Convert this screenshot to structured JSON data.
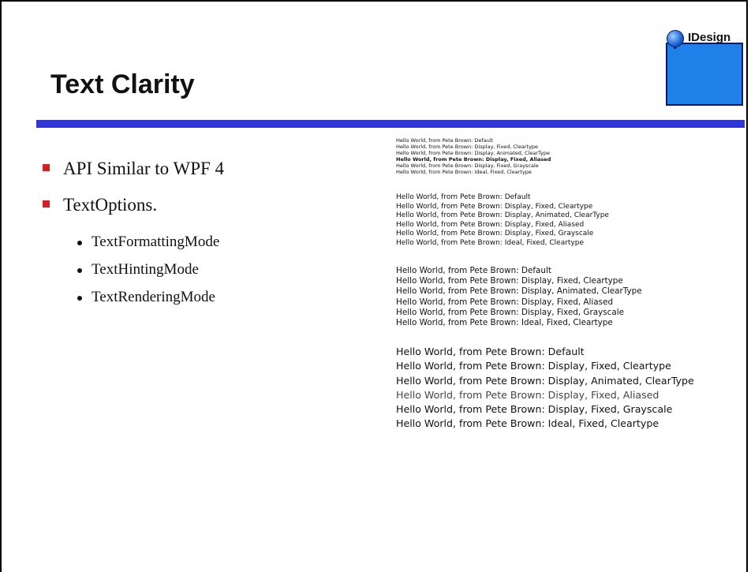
{
  "slide": {
    "title": "Text Clarity",
    "logo": {
      "text": "IDesign"
    },
    "accent_colors": {
      "rule": "#2f37d6",
      "bullet": "#d42027",
      "logo_box": "#1e80e8"
    },
    "bullets": [
      {
        "text": "API Similar to WPF 4",
        "sub": []
      },
      {
        "text": "TextOptions.",
        "sub": [
          "TextFormattingMode",
          "TextHintingMode",
          "TextRenderingMode"
        ]
      }
    ],
    "sample_groups": [
      {
        "lines": [
          "Hello World, from Pete Brown: Default",
          "Hello World, from Pete Brown: Display, Fixed, Cleartype",
          "Hello World, from Pete Brown: Display, Animated, ClearType",
          "Hello World, from Pete Brown: Display, Fixed, Aliased",
          "Hello World, from Pete Brown: Display, Fixed, Grayscale",
          "Hello World, from Pete Brown: Ideal, Fixed, Cleartype"
        ]
      },
      {
        "lines": [
          "Hello World, from Pete Brown: Default",
          "Hello World, from Pete Brown: Display, Fixed, Cleartype",
          "Hello World, from Pete Brown: Display, Animated, ClearType",
          "Hello World, from Pete Brown: Display, Fixed, Aliased",
          "Hello World, from Pete Brown: Display, Fixed, Grayscale",
          "Hello World, from Pete Brown: Ideal, Fixed, Cleartype"
        ]
      },
      {
        "lines": [
          "Hello World, from Pete Brown: Default",
          "Hello World, from Pete Brown: Display, Fixed, Cleartype",
          "Hello World, from Pete Brown: Display, Animated, ClearType",
          "Hello World, from Pete Brown: Display, Fixed, Aliased",
          "Hello World, from Pete Brown: Display, Fixed, Grayscale",
          "Hello World, from Pete Brown: Ideal, Fixed, Cleartype"
        ]
      },
      {
        "lines": [
          "Hello World, from Pete Brown: Default",
          "Hello World, from Pete Brown: Display, Fixed, Cleartype",
          "Hello World, from Pete Brown: Display, Animated, ClearType",
          "Hello World, from Pete Brown: Display, Fixed, Aliased",
          "Hello World, from Pete Brown: Display, Fixed, Grayscale",
          "Hello World, from Pete Brown: Ideal, Fixed, Cleartype"
        ]
      }
    ]
  }
}
